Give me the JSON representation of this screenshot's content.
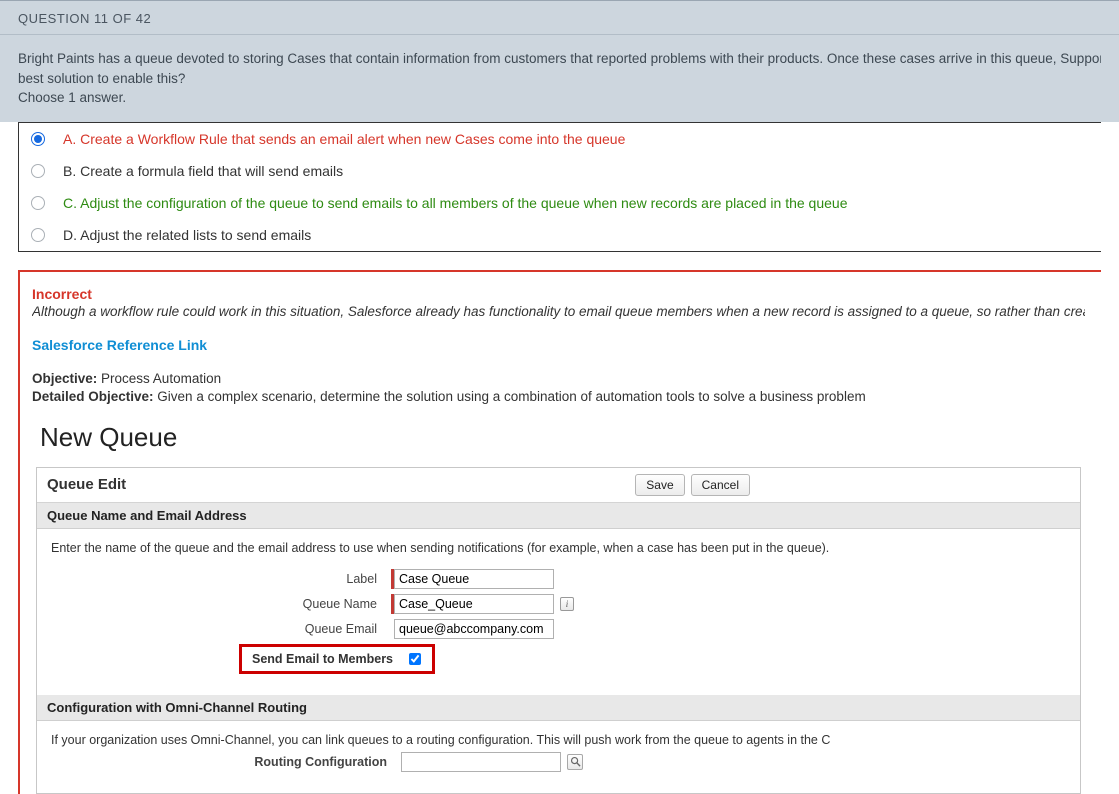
{
  "questionHeader": "QUESTION 11 OF 42",
  "questionText1": "Bright Paints has a queue devoted to storing Cases that contain information from customers that reported problems with their products. Once these cases arrive in this queue, Support Management wants emails to automatically",
  "questionText2": "best solution to enable this?",
  "questionText3": "Choose 1 answer.",
  "answers": {
    "a": "A. Create a Workflow Rule that sends an email alert when new Cases come into the queue",
    "b": "B. Create a formula field that will send emails",
    "c": "C. Adjust the configuration of the queue to send emails to all members of the queue when new records are placed in the queue",
    "d": "D. Adjust the related lists to send emails"
  },
  "feedback": {
    "title": "Incorrect",
    "explanation": "Although a workflow rule could work in this situation, Salesforce already has functionality to email queue members when a new record is assigned to a queue, so rather than creating a workflow rule,",
    "refLink": "Salesforce Reference Link",
    "objLabel": "Objective:",
    "objValue": " Process Automation",
    "detObjLabel": "Detailed Objective:",
    "detObjValue": " Given a complex scenario, determine the solution using a combination of automation tools to solve a business problem"
  },
  "embed": {
    "title": "New Queue",
    "panelTitle": "Queue Edit",
    "saveLabel": "Save",
    "cancelLabel": "Cancel",
    "section1Title": "Queue Name and Email Address",
    "section1Intro": "Enter the name of the queue and the email address to use when sending notifications (for example, when a case has been put in the queue).",
    "labelLabel": "Label",
    "labelValue": "Case Queue",
    "nameLabel": "Queue Name",
    "nameValue": "Case_Queue",
    "emailLabel": "Queue Email",
    "emailValue": "queue@abccompany.com",
    "sendEmailLabel": "Send Email to Members",
    "section2Title": "Configuration with Omni-Channel Routing",
    "section2Text": "If your organization uses Omni-Channel, you can link queues to a routing configuration. This will push work from the queue to agents in the C",
    "routingLabel": "Routing Configuration"
  }
}
